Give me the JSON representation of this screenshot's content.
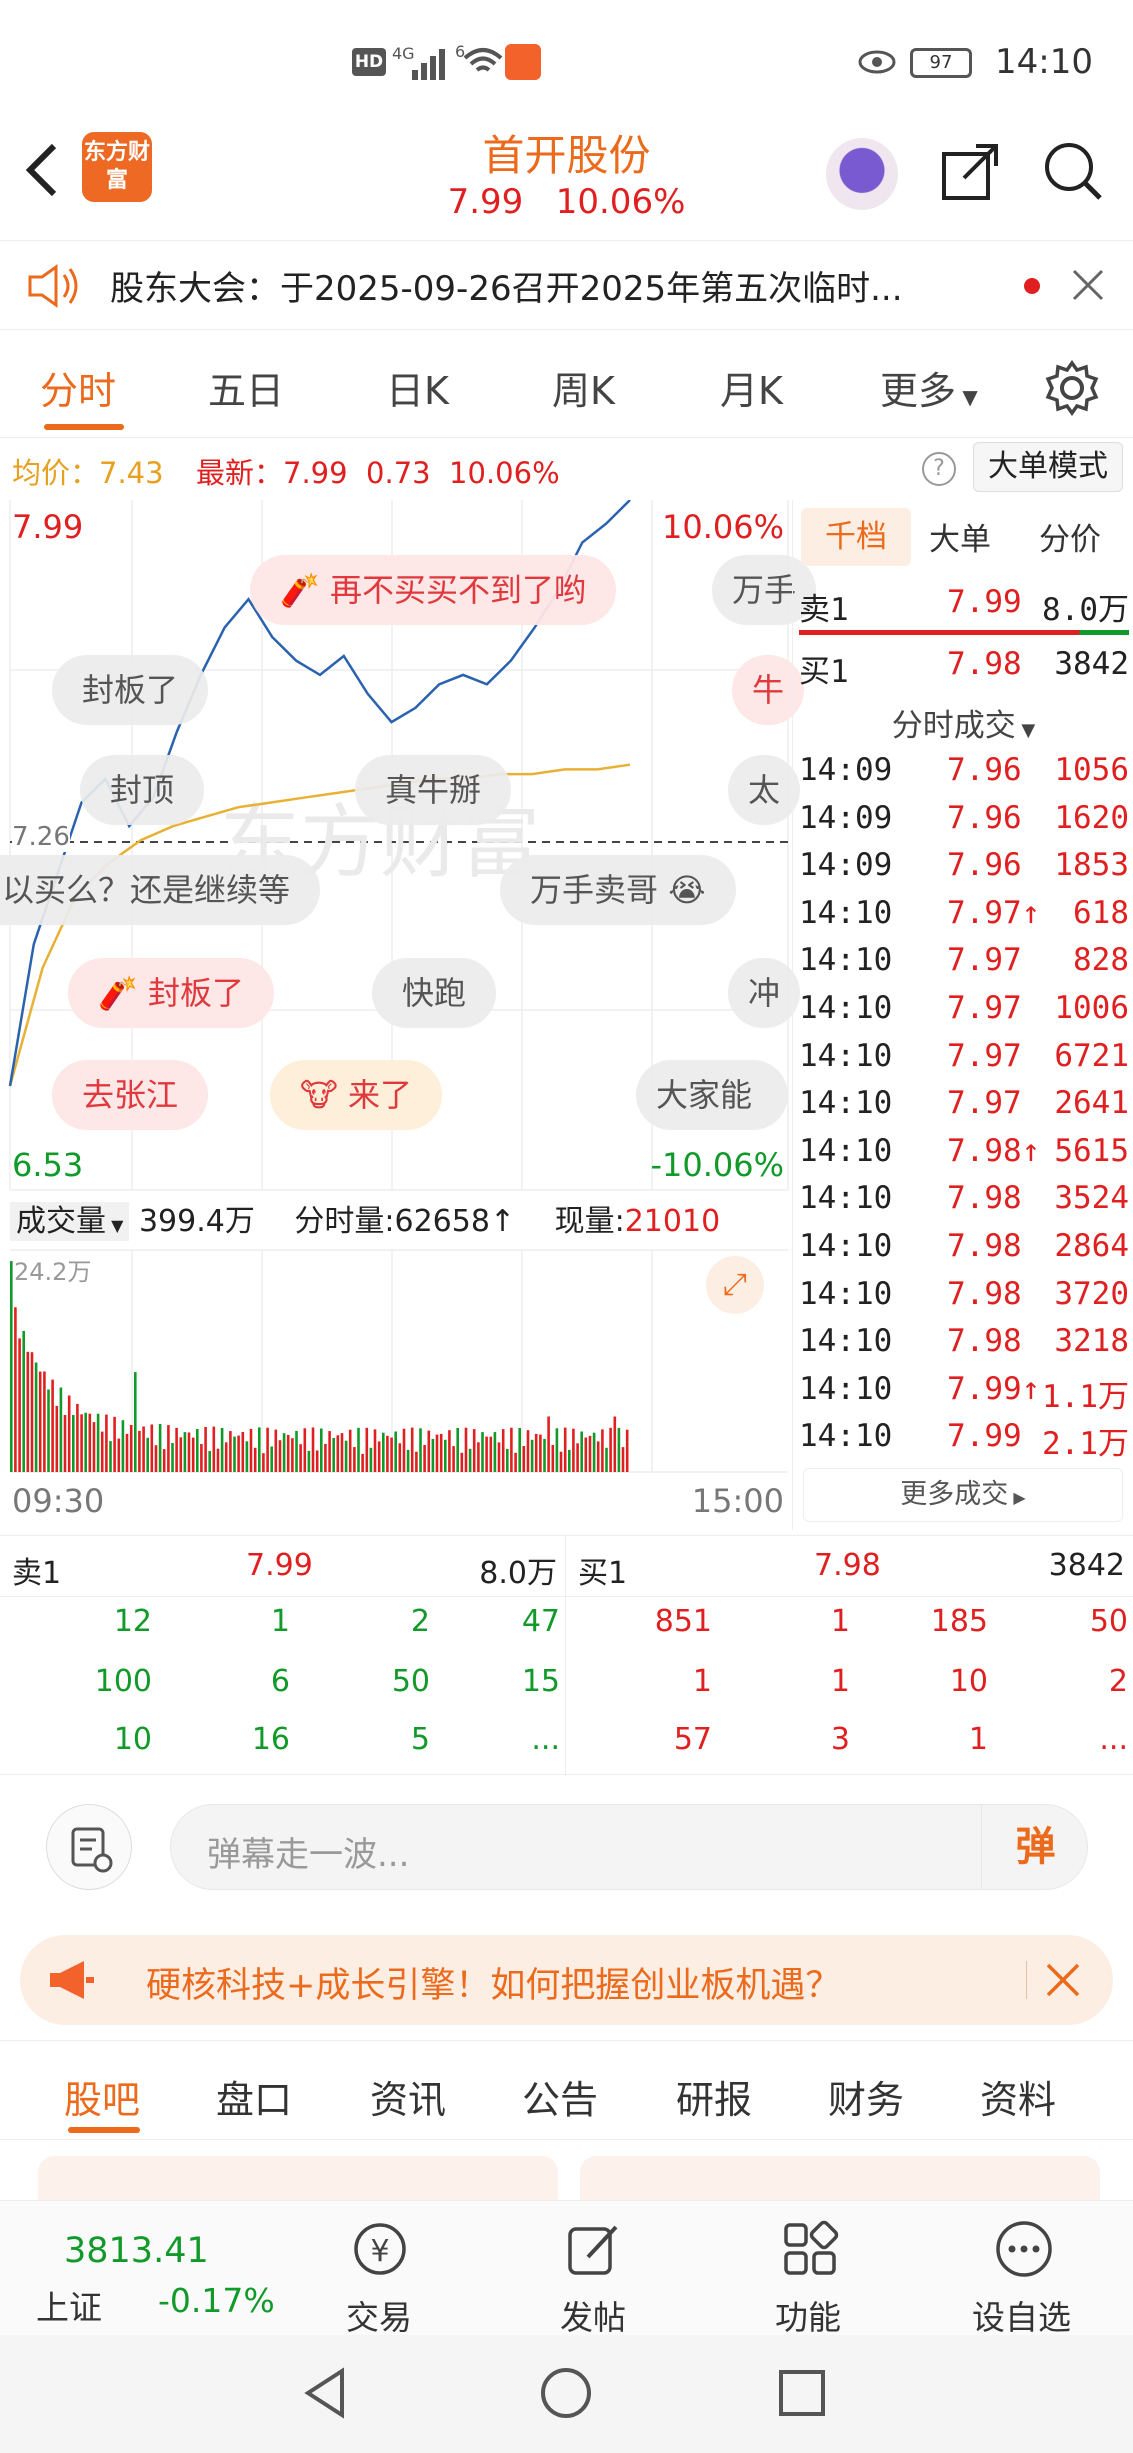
{
  "status_bar": {
    "network": "4G",
    "signal": "6",
    "battery": "97",
    "time": "14:10"
  },
  "header": {
    "logo_text": "东方财富",
    "title": "首开股份",
    "price": "7.99",
    "change_pct": "10.06%"
  },
  "notice": {
    "text": "股东大会：于2025-09-26召开2025年第五次临时..."
  },
  "tabs": [
    "分时",
    "五日",
    "日K",
    "周K",
    "月K",
    "更多"
  ],
  "info": {
    "avg_label": "均价：",
    "avg": "7.43",
    "latest_label": "最新：",
    "latest": "7.99",
    "change": "0.73",
    "pct": "10.06%",
    "mode_button": "大单模式"
  },
  "chart": {
    "price_top": "7.99",
    "pct_top": "10.06%",
    "price_bottom": "6.53",
    "pct_bottom": "-10.06%",
    "prev_close": "7.26",
    "watermark": "东方财富",
    "volume_label": "成交量",
    "volume_total": "399.4万",
    "minute_vol_label": "分时量:",
    "minute_vol": "62658",
    "current_vol_label": "现量:",
    "current_vol": "21010",
    "vol_max": "24.2万",
    "time_start": "09:30",
    "time_end": "15:00"
  },
  "chart_data": {
    "type": "line",
    "x_range": [
      "09:30",
      "14:10"
    ],
    "ylim": [
      6.53,
      7.99
    ],
    "price_series_approx": [
      6.75,
      7.05,
      7.2,
      7.35,
      7.4,
      7.3,
      7.36,
      7.5,
      7.62,
      7.72,
      7.78,
      7.7,
      7.65,
      7.62,
      7.66,
      7.58,
      7.52,
      7.55,
      7.6,
      7.62,
      7.6,
      7.65,
      7.72,
      7.8,
      7.9,
      7.94,
      7.99
    ],
    "avg_series_approx": [
      6.75,
      7.0,
      7.15,
      7.22,
      7.27,
      7.3,
      7.32,
      7.34,
      7.35,
      7.36,
      7.37,
      7.38,
      7.39,
      7.4,
      7.4,
      7.41,
      7.41,
      7.42,
      7.42,
      7.43
    ],
    "volume_max": "24.2万"
  },
  "danmu": [
    "再不买买不到了哟",
    "万手",
    "封板了",
    "牛",
    "封顶",
    "真牛掰",
    "太",
    "以买么？还是继续等",
    "万手卖哥",
    "封板了",
    "快跑",
    "冲",
    "去张江",
    "来了",
    "大家能"
  ],
  "right_panel": {
    "tabs": [
      "千档",
      "大单",
      "分价"
    ],
    "sell1": {
      "label": "卖1",
      "price": "7.99",
      "vol": "8.0万"
    },
    "buy1": {
      "label": "买1",
      "price": "7.98",
      "vol": "3842"
    },
    "trades_title": "分时成交",
    "trades": [
      {
        "t": "14:09",
        "p": "7.96",
        "v": "1056"
      },
      {
        "t": "14:09",
        "p": "7.96",
        "v": "1620"
      },
      {
        "t": "14:09",
        "p": "7.96",
        "v": "1853"
      },
      {
        "t": "14:10",
        "p": "7.97↑",
        "v": "618"
      },
      {
        "t": "14:10",
        "p": "7.97",
        "v": "828"
      },
      {
        "t": "14:10",
        "p": "7.97",
        "v": "1006"
      },
      {
        "t": "14:10",
        "p": "7.97",
        "v": "6721"
      },
      {
        "t": "14:10",
        "p": "7.97",
        "v": "2641"
      },
      {
        "t": "14:10",
        "p": "7.98↑",
        "v": "5615"
      },
      {
        "t": "14:10",
        "p": "7.98",
        "v": "3524"
      },
      {
        "t": "14:10",
        "p": "7.98",
        "v": "2864"
      },
      {
        "t": "14:10",
        "p": "7.98",
        "v": "3720"
      },
      {
        "t": "14:10",
        "p": "7.98",
        "v": "3218"
      },
      {
        "t": "14:10",
        "p": "7.99↑",
        "v": "1.1万"
      },
      {
        "t": "14:10",
        "p": "7.99",
        "v": "2.1万"
      }
    ],
    "more": "更多成交"
  },
  "queue": {
    "sell_label": "卖1",
    "sell_price": "7.99",
    "sell_vol": "8.0万",
    "buy_label": "买1",
    "buy_price": "7.98",
    "buy_vol": "3842",
    "sell_rows": [
      [
        "12",
        "1",
        "2",
        "47"
      ],
      [
        "100",
        "6",
        "50",
        "15"
      ],
      [
        "10",
        "16",
        "5",
        "..."
      ]
    ],
    "buy_rows": [
      [
        "851",
        "1",
        "185",
        "50"
      ],
      [
        "1",
        "1",
        "10",
        "2"
      ],
      [
        "57",
        "3",
        "1",
        "..."
      ]
    ]
  },
  "comment": {
    "placeholder": "弹幕走一波...",
    "send_label": "弹"
  },
  "ad": {
    "text": "硬核科技+成长引擎！如何把握创业板机遇？"
  },
  "section_tabs": [
    "股吧",
    "盘口",
    "资讯",
    "公告",
    "研报",
    "财务",
    "资料"
  ],
  "bottom_nav": {
    "index_value": "3813.41",
    "index_name": "上证",
    "index_change": "-0.17%",
    "items": [
      "交易",
      "发帖",
      "功能",
      "设自选"
    ]
  },
  "colors": {
    "accent": "#ec6a1c",
    "up": "#e02020",
    "down": "#119a2a",
    "price_line": "#2a62b0",
    "avg_line": "#e8b035"
  }
}
